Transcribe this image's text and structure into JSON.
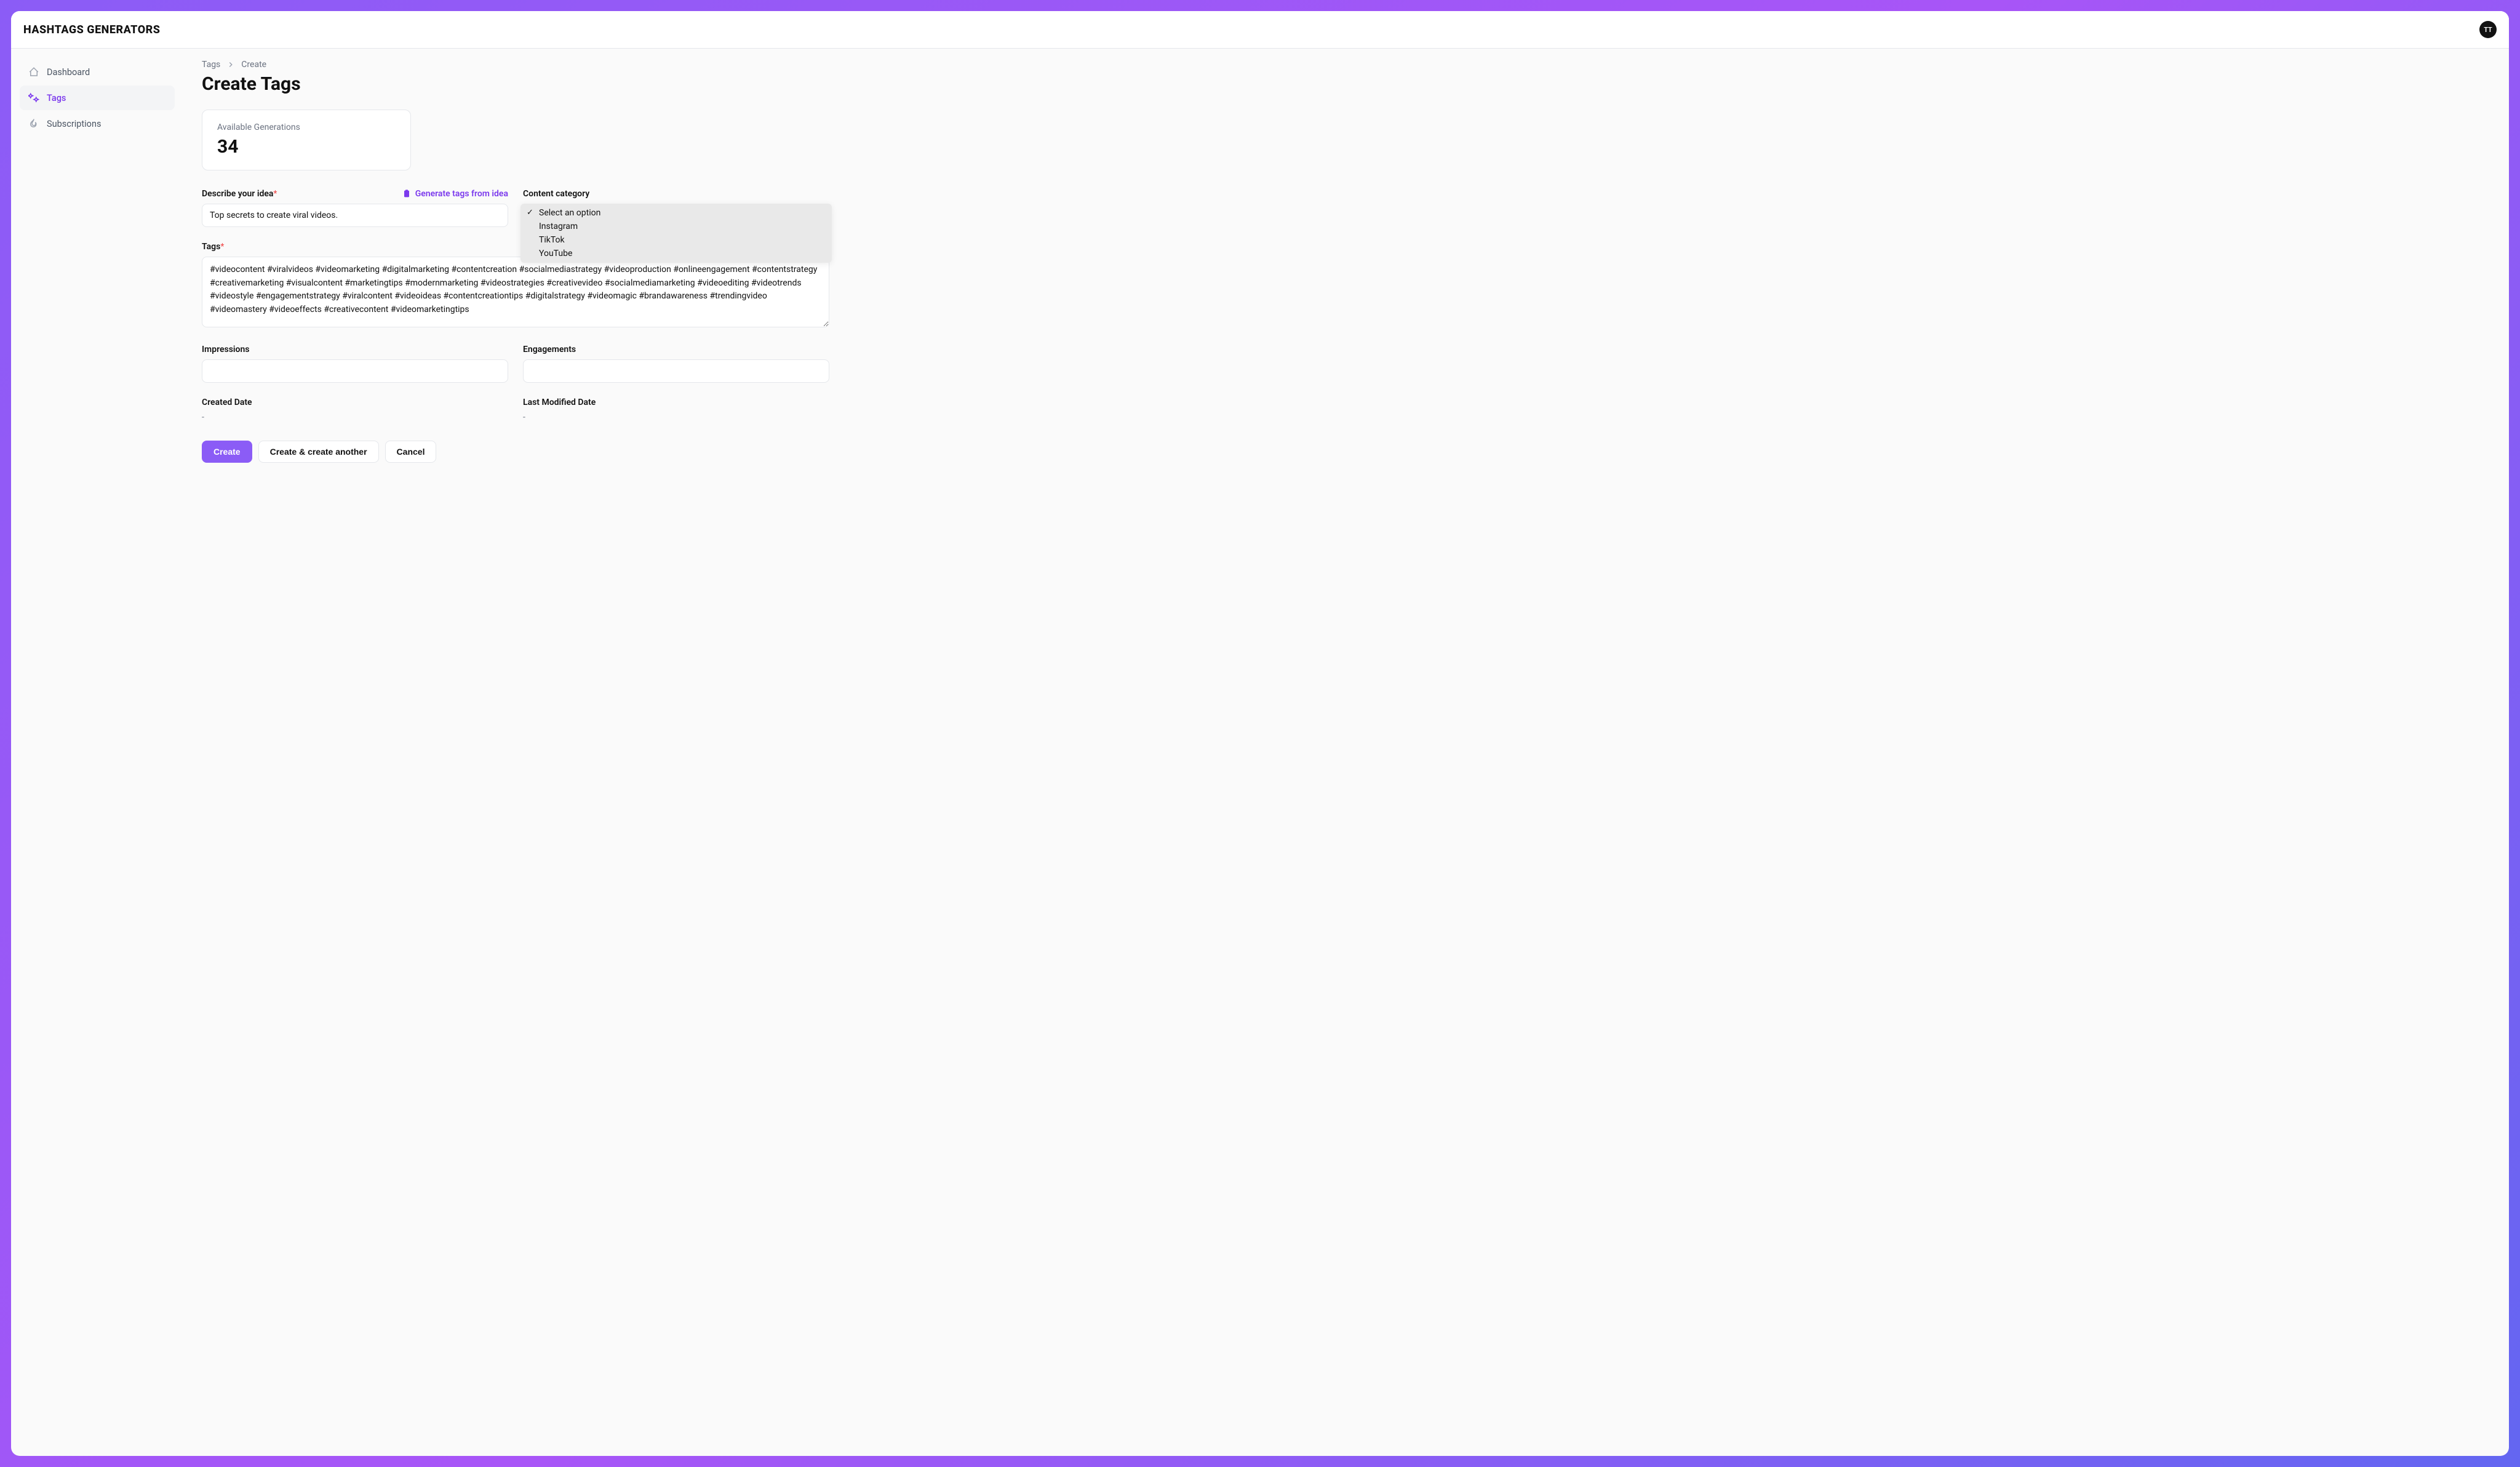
{
  "brand": "HASHTAGS GENERATORS",
  "avatar": "TT",
  "sidebar": {
    "items": [
      {
        "label": "Dashboard"
      },
      {
        "label": "Tags"
      },
      {
        "label": "Subscriptions"
      }
    ]
  },
  "breadcrumb": {
    "root": "Tags",
    "current": "Create"
  },
  "page_title": "Create Tags",
  "card": {
    "label": "Available Generations",
    "value": "34"
  },
  "form": {
    "describe_label": "Describe your idea",
    "generate_link": "Generate tags from idea",
    "describe_value": "Top secrets to create viral videos.",
    "category_label": "Content category",
    "category_options": [
      "Select an option",
      "Instagram",
      "TikTok",
      "YouTube"
    ],
    "tags_label": "Tags",
    "tags_value": "#videocontent #viralvideos #videomarketing #digitalmarketing #contentcreation #socialmediastrategy #videoproduction #onlineengagement #contentstrategy #creativemarketing #visualcontent #marketingtips #modernmarketing #videostrategies #creativevideo #socialmediamarketing #videoediting #videotrends #videostyle #engagementstrategy #viralcontent #videoideas #contentcreationtips #digitalstrategy #videomagic #brandawareness #trendingvideo #videomastery #videoeffects #creativecontent #videomarketingtips",
    "impressions_label": "Impressions",
    "engagements_label": "Engagements",
    "created_label": "Created Date",
    "created_value": "-",
    "modified_label": "Last Modified Date",
    "modified_value": "-"
  },
  "actions": {
    "create": "Create",
    "create_another": "Create & create another",
    "cancel": "Cancel"
  }
}
